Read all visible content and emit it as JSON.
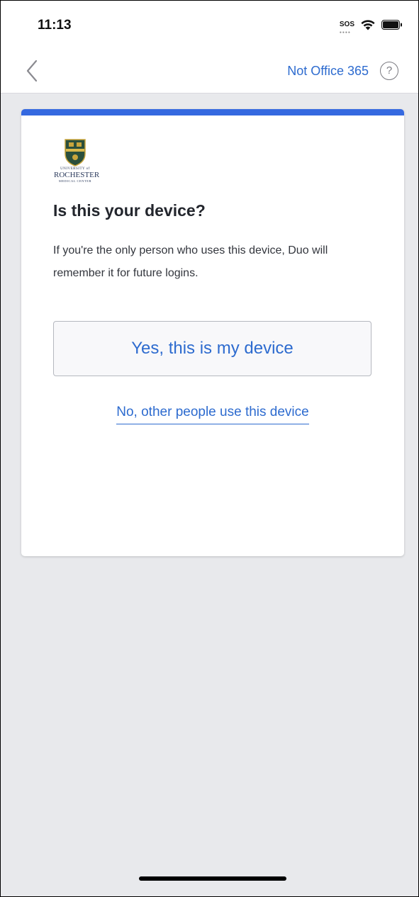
{
  "status_bar": {
    "time": "11:13",
    "sos_label": "SOS",
    "icons": [
      "wifi-icon",
      "battery-icon"
    ]
  },
  "nav": {
    "back_icon": "chevron-left-icon",
    "not_office_label": "Not Office 365",
    "help_label": "?"
  },
  "card": {
    "accent_color": "#3569e0",
    "logo": {
      "line1": "UNIVERSITY of",
      "line2": "ROCHESTER",
      "line3": "MEDICAL CENTER"
    },
    "title": "Is this your device?",
    "description": "If you're the only person who uses this device, Duo will remember it for future logins.",
    "primary_button": "Yes, this is my device",
    "secondary_link": "No, other people use this device"
  },
  "colors": {
    "link_blue": "#2d6bcf",
    "background": "#e8e9ec"
  }
}
